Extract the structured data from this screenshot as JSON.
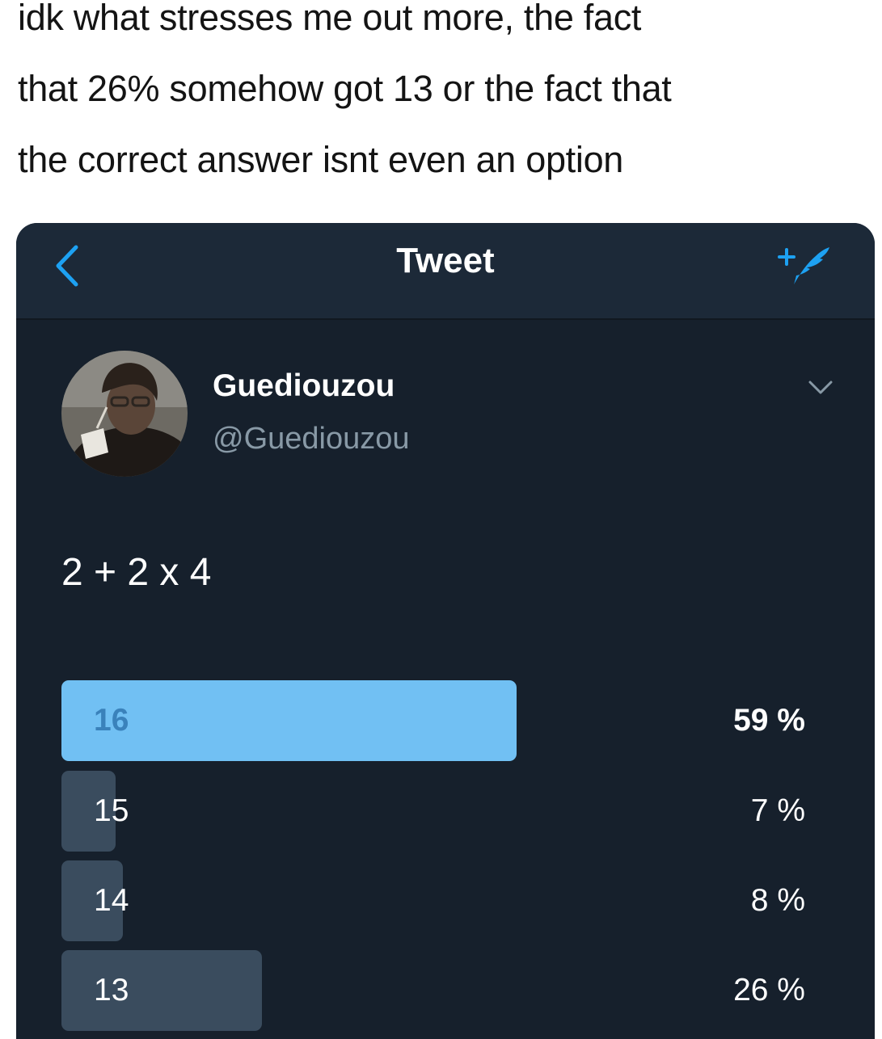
{
  "caption": {
    "lines": [
      "idk what stresses me out more, the fact",
      "that 26% somehow got 13 or the fact that",
      "the correct answer isnt even an option"
    ]
  },
  "header": {
    "title": "Tweet",
    "back_icon": "chevron-left-icon",
    "compose_icon": "compose-tweet-icon"
  },
  "tweet": {
    "display_name": "Guediouzou",
    "handle": "@Guediouzou",
    "text": "2 + 2 x 4",
    "avatar_icon": "profile-photo",
    "menu_icon": "chevron-down-icon"
  },
  "poll": {
    "options": [
      {
        "label": "16",
        "percent": 59,
        "percent_label": "59 %",
        "leading": true
      },
      {
        "label": "15",
        "percent": 7,
        "percent_label": "7 %",
        "leading": false
      },
      {
        "label": "14",
        "percent": 8,
        "percent_label": "8 %",
        "leading": false
      },
      {
        "label": "13",
        "percent": 26,
        "percent_label": "26 %",
        "leading": false
      }
    ]
  },
  "colors": {
    "background": "#16202c",
    "navbar": "#1c2938",
    "accent": "#1da1f2",
    "leading_bar": "#71c0f3",
    "other_bar": "#3a4c5e",
    "secondary_text": "#8899a6"
  }
}
